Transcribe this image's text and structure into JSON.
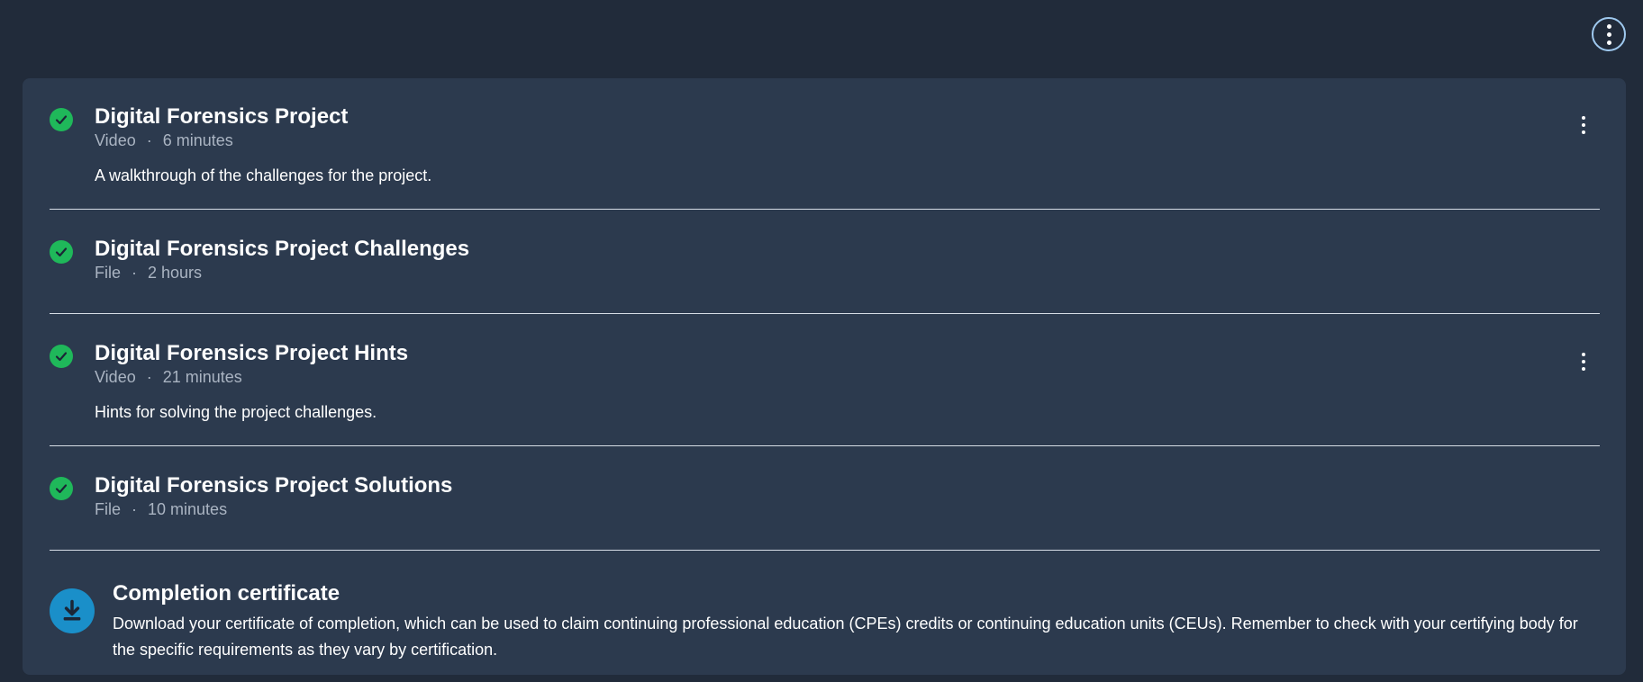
{
  "items": [
    {
      "title": "Digital Forensics Project",
      "type": "Video",
      "separator": "·",
      "duration": "6 minutes",
      "description": "A walkthrough of the challenges for the project.",
      "completed": true
    },
    {
      "title": "Digital Forensics Project Challenges",
      "type": "File",
      "separator": "·",
      "duration": "2 hours",
      "completed": true
    },
    {
      "title": "Digital Forensics Project Hints",
      "type": "Video",
      "separator": "·",
      "duration": "21 minutes",
      "description": "Hints for solving the project challenges.",
      "completed": true
    },
    {
      "title": "Digital Forensics Project Solutions",
      "type": "File",
      "separator": "·",
      "duration": "10 minutes",
      "completed": true
    }
  ],
  "certificate": {
    "title": "Completion certificate",
    "description": "Download your certificate of completion, which can be used to claim continuing professional education (CPEs) credits or continuing education units (CEUs). Remember to check with your certifying body for the specific requirements as they vary by certification."
  },
  "icons": {
    "top_menu": "more-vertical-icon",
    "completed": "check-circle-icon",
    "item_menu": "more-vertical-icon",
    "download": "download-icon"
  },
  "colors": {
    "background": "#212b3a",
    "panel": "#2c3a4e",
    "check": "#1fb85a",
    "download": "#1a8fc9",
    "meta_text": "#aab4c2"
  }
}
